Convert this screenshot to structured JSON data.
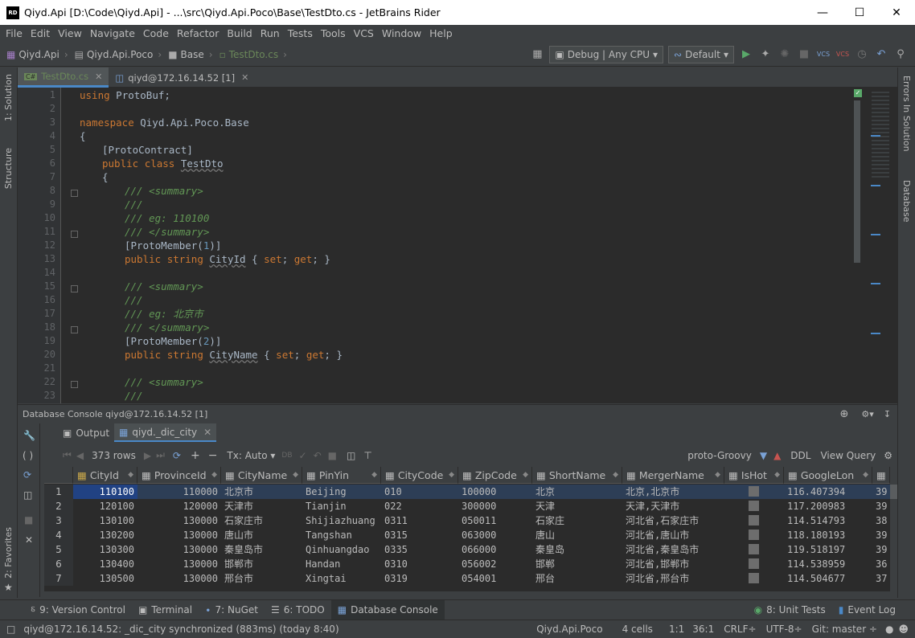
{
  "window": {
    "app_badge": "RD",
    "title": "Qiyd.Api [D:\\Code\\Qiyd.Api] - ...\\src\\Qiyd.Api.Poco\\Base\\TestDto.cs - JetBrains Rider"
  },
  "menu": [
    "File",
    "Edit",
    "View",
    "Navigate",
    "Code",
    "Refactor",
    "Build",
    "Run",
    "Tests",
    "Tools",
    "VCS",
    "Window",
    "Help"
  ],
  "breadcrumbs": [
    "Qiyd.Api",
    "Qiyd.Api.Poco",
    "Base",
    "TestDto.cs"
  ],
  "toolbar": {
    "config": "Debug | Any CPU",
    "profile": "Default"
  },
  "left_tools": {
    "solution": "1: Solution",
    "structure": "Structure",
    "favorites": "2: Favorites"
  },
  "right_tools": {
    "errors": "Errors In Solution",
    "database": "Database"
  },
  "editor_tabs": [
    {
      "label": "TestDto.cs",
      "badge": "C#"
    },
    {
      "label": "qiyd@172.16.14.52 [1]"
    }
  ],
  "code_lines": [
    {
      "n": "1"
    },
    {
      "n": "2"
    },
    {
      "n": "3"
    },
    {
      "n": "4"
    },
    {
      "n": "5"
    },
    {
      "n": "6"
    },
    {
      "n": "7"
    },
    {
      "n": "8"
    },
    {
      "n": "9"
    },
    {
      "n": "10"
    },
    {
      "n": "11"
    },
    {
      "n": "12"
    },
    {
      "n": "13"
    },
    {
      "n": "14"
    },
    {
      "n": "15"
    },
    {
      "n": "16"
    },
    {
      "n": "17"
    },
    {
      "n": "18"
    },
    {
      "n": "19"
    },
    {
      "n": "20"
    },
    {
      "n": "21"
    },
    {
      "n": "22"
    },
    {
      "n": "23"
    }
  ],
  "code": {
    "l1a": "using",
    "l1b": " ProtoBuf;",
    "l3a": "namespace",
    "l3b": " Qiyd.Api.Poco.Base",
    "l4": "{",
    "l5": "[ProtoContract]",
    "l6a": "public",
    "l6b": "class",
    "l6c": "TestDto",
    "l7": "{",
    "l8": "/// <summary>",
    "l9": "///",
    "l10": "/// eg: 110100",
    "l11": "/// </summary>",
    "l12a": "[ProtoMember(",
    "l12b": "1",
    "l12c": ")]",
    "l13a": "public",
    "l13b": "string",
    "l13c": "CityId",
    "l13d": " { ",
    "l13e": "set",
    "l13f": "; ",
    "l13g": "get",
    "l13h": "; }",
    "l15": "/// <summary>",
    "l16": "///",
    "l17": "/// eg: 北京市",
    "l18": "/// </summary>",
    "l19a": "[ProtoMember(",
    "l19b": "2",
    "l19c": ")]",
    "l20a": "public",
    "l20b": "string",
    "l20c": "CityName",
    "l20d": " { ",
    "l20e": "set",
    "l20f": "; ",
    "l20g": "get",
    "l20h": "; }",
    "l22": "/// <summary>",
    "l23": "///"
  },
  "db_console": {
    "header": "Database Console qiyd@172.16.14.52 [1]",
    "tabs": [
      "Output",
      "qiyd._dic_city"
    ],
    "rows_label": "373 rows",
    "tx_label": "Tx: Auto",
    "extractor": "proto-Groovy",
    "ddl": "DDL",
    "view_query": "View Query"
  },
  "grid": {
    "columns": [
      "CityId",
      "ProvinceId",
      "CityName",
      "PinYin",
      "CityCode",
      "ZipCode",
      "ShortName",
      "MergerName",
      "IsHot",
      "GoogleLon",
      ""
    ],
    "rows": [
      [
        "1",
        "110100",
        "110000",
        "北京市",
        "Beijing",
        "010",
        "100000",
        "北京",
        "北京,北京市",
        "",
        "116.407394",
        "39"
      ],
      [
        "2",
        "120100",
        "120000",
        "天津市",
        "Tianjin",
        "022",
        "300000",
        "天津",
        "天津,天津市",
        "",
        "117.200983",
        "39"
      ],
      [
        "3",
        "130100",
        "130000",
        "石家庄市",
        "Shijiazhuang",
        "0311",
        "050011",
        "石家庄",
        "河北省,石家庄市",
        "",
        "114.514793",
        "38"
      ],
      [
        "4",
        "130200",
        "130000",
        "唐山市",
        "Tangshan",
        "0315",
        "063000",
        "唐山",
        "河北省,唐山市",
        "",
        "118.180193",
        "39"
      ],
      [
        "5",
        "130300",
        "130000",
        "秦皇岛市",
        "Qinhuangdao",
        "0335",
        "066000",
        "秦皇岛",
        "河北省,秦皇岛市",
        "",
        "119.518197",
        "39"
      ],
      [
        "6",
        "130400",
        "130000",
        "邯郸市",
        "Handan",
        "0310",
        "056002",
        "邯郸",
        "河北省,邯郸市",
        "",
        "114.538959",
        "36"
      ],
      [
        "7",
        "130500",
        "130000",
        "邢台市",
        "Xingtai",
        "0319",
        "054001",
        "邢台",
        "河北省,邢台市",
        "",
        "114.504677",
        "37"
      ]
    ]
  },
  "bottom_tools": [
    "9: Version Control",
    "Terminal",
    "7: NuGet",
    "6: TODO",
    "Database Console",
    "8: Unit Tests",
    "Event Log"
  ],
  "status": {
    "message": "qiyd@172.16.14.52: _dic_city synchronized (883ms) (today 8:40)",
    "project": "Qiyd.Api.Poco",
    "cells": "4 cells",
    "pos1": "1:1",
    "pos2": "36:1",
    "crlf": "CRLF÷",
    "enc": "UTF-8÷",
    "git": "Git: master ÷"
  },
  "colors": {
    "accent": "#4a88c7",
    "selected_row": "#214283",
    "editor_bg": "#2b2b2b",
    "keyword": "#cc7832",
    "comment": "#629755"
  }
}
